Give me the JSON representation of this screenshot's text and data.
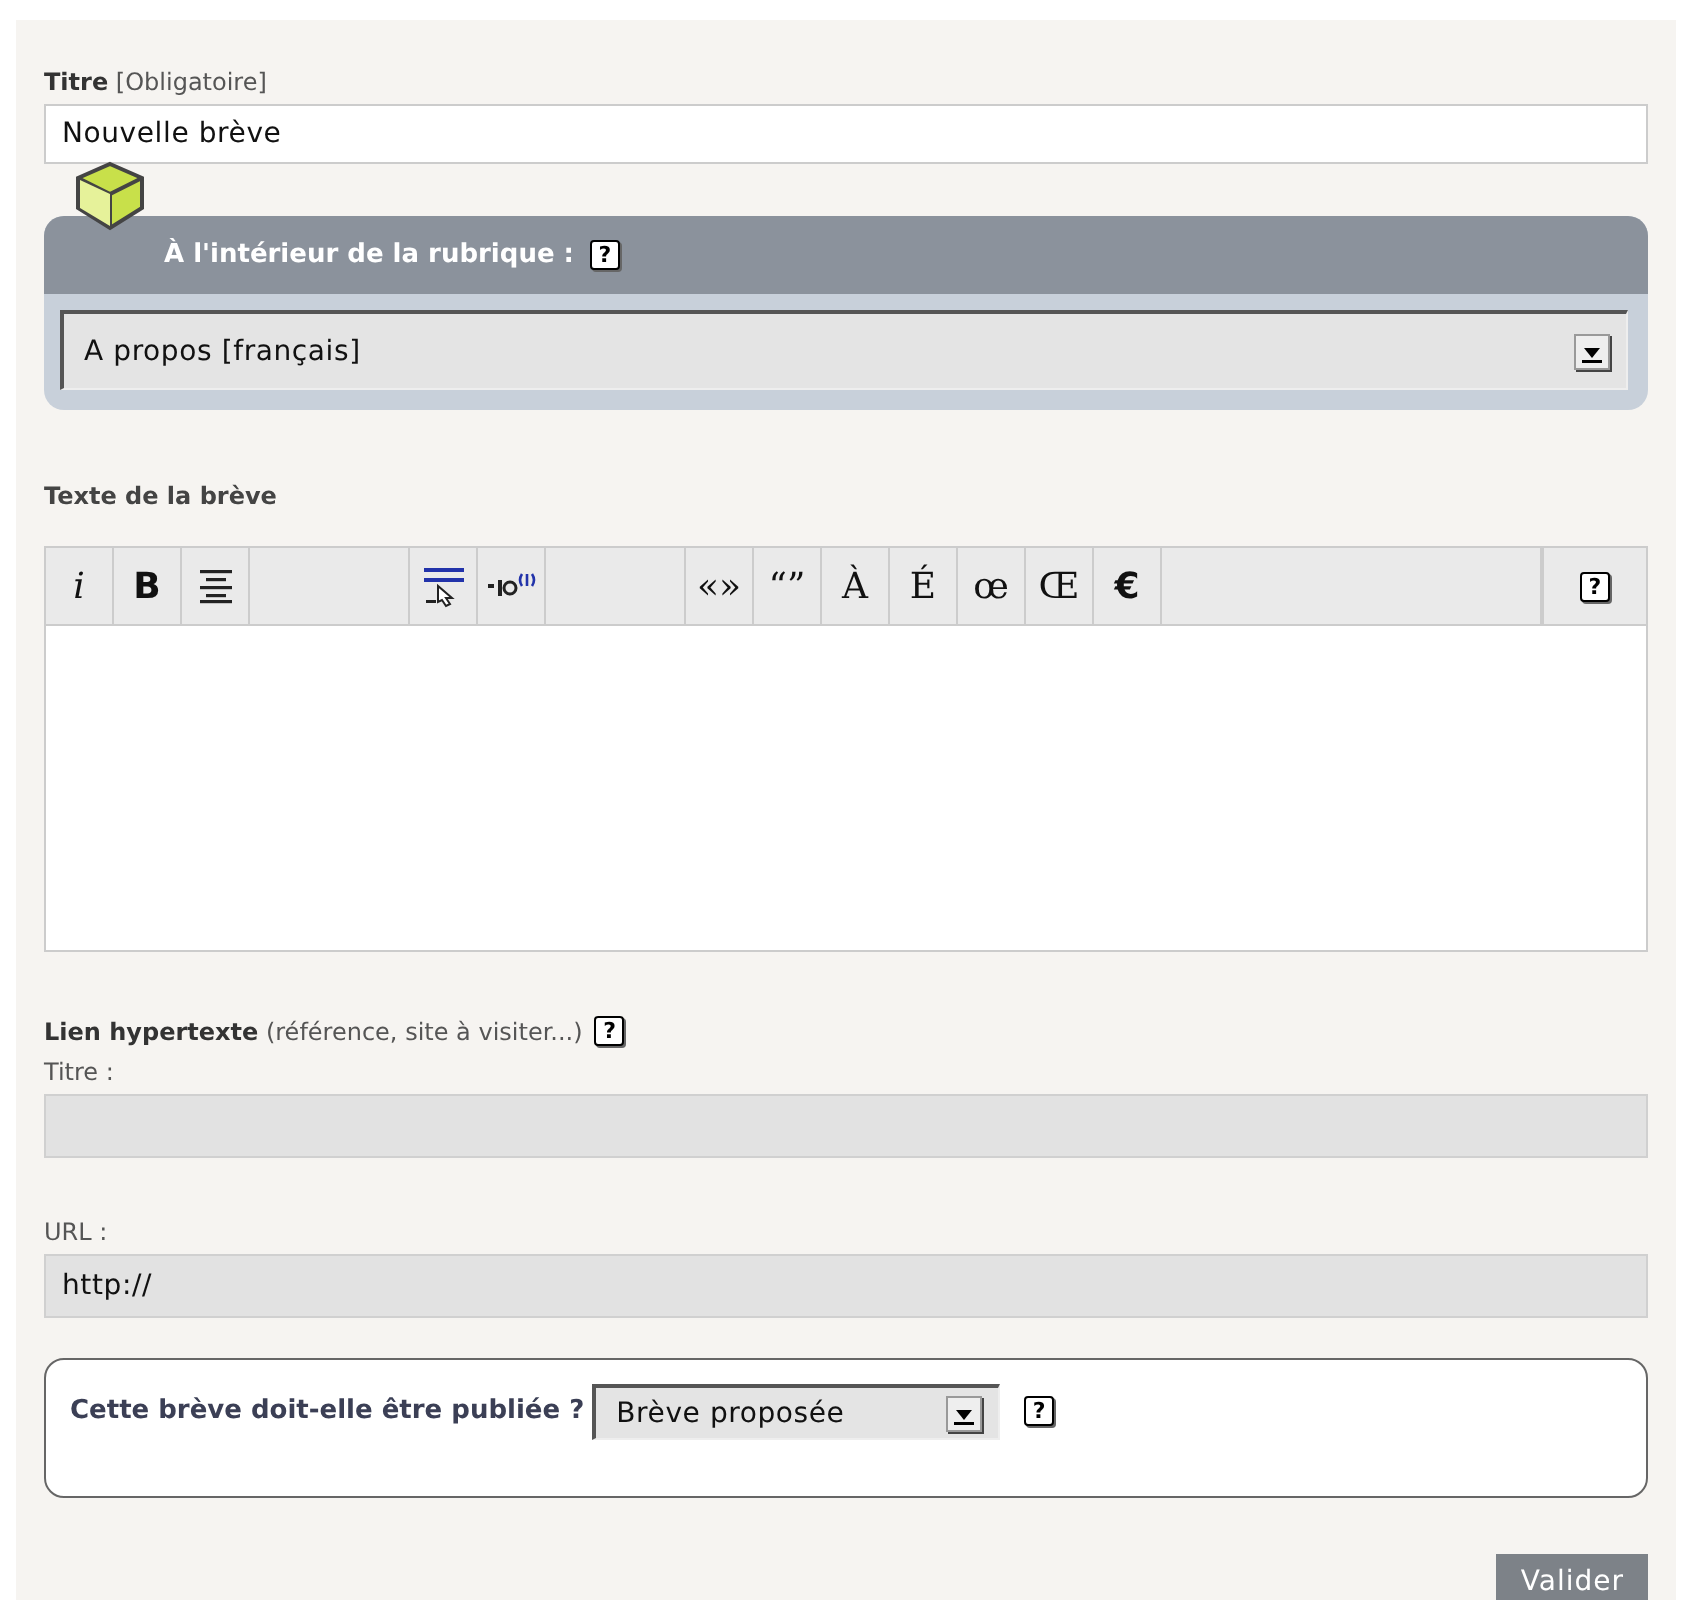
{
  "title_field": {
    "label": "Titre",
    "note": "[Obligatoire]",
    "value": "Nouvelle brève"
  },
  "rubrique": {
    "heading": "À l'intérieur de la rubrique :",
    "help": "?",
    "select": "A propos [français]"
  },
  "text_field": {
    "label": "Texte de la brève",
    "toolbar": [
      {
        "kind": "italic",
        "text": "i"
      },
      {
        "kind": "bold",
        "text": "B"
      },
      {
        "kind": "align"
      },
      {
        "kind": "spacer"
      },
      {
        "kind": "link"
      },
      {
        "kind": "note"
      },
      {
        "kind": "spacer"
      },
      {
        "kind": "char",
        "text": "«»"
      },
      {
        "kind": "char",
        "text": "“”"
      },
      {
        "kind": "char",
        "text": "À"
      },
      {
        "kind": "char",
        "text": "É"
      },
      {
        "kind": "char",
        "text": "œ"
      },
      {
        "kind": "char",
        "text": "Œ"
      },
      {
        "kind": "bold",
        "text": "€"
      },
      {
        "kind": "fill"
      },
      {
        "kind": "help",
        "text": "?"
      }
    ]
  },
  "link": {
    "label": "Lien hypertexte",
    "note": "(référence, site à visiter...)",
    "help": "?",
    "title_label": "Titre :",
    "url_label": "URL :",
    "url_value": "http://"
  },
  "status": {
    "question": "Cette brève doit-elle être publiée ?",
    "select": "Brève proposée",
    "help": "?"
  },
  "submit": "Valider"
}
